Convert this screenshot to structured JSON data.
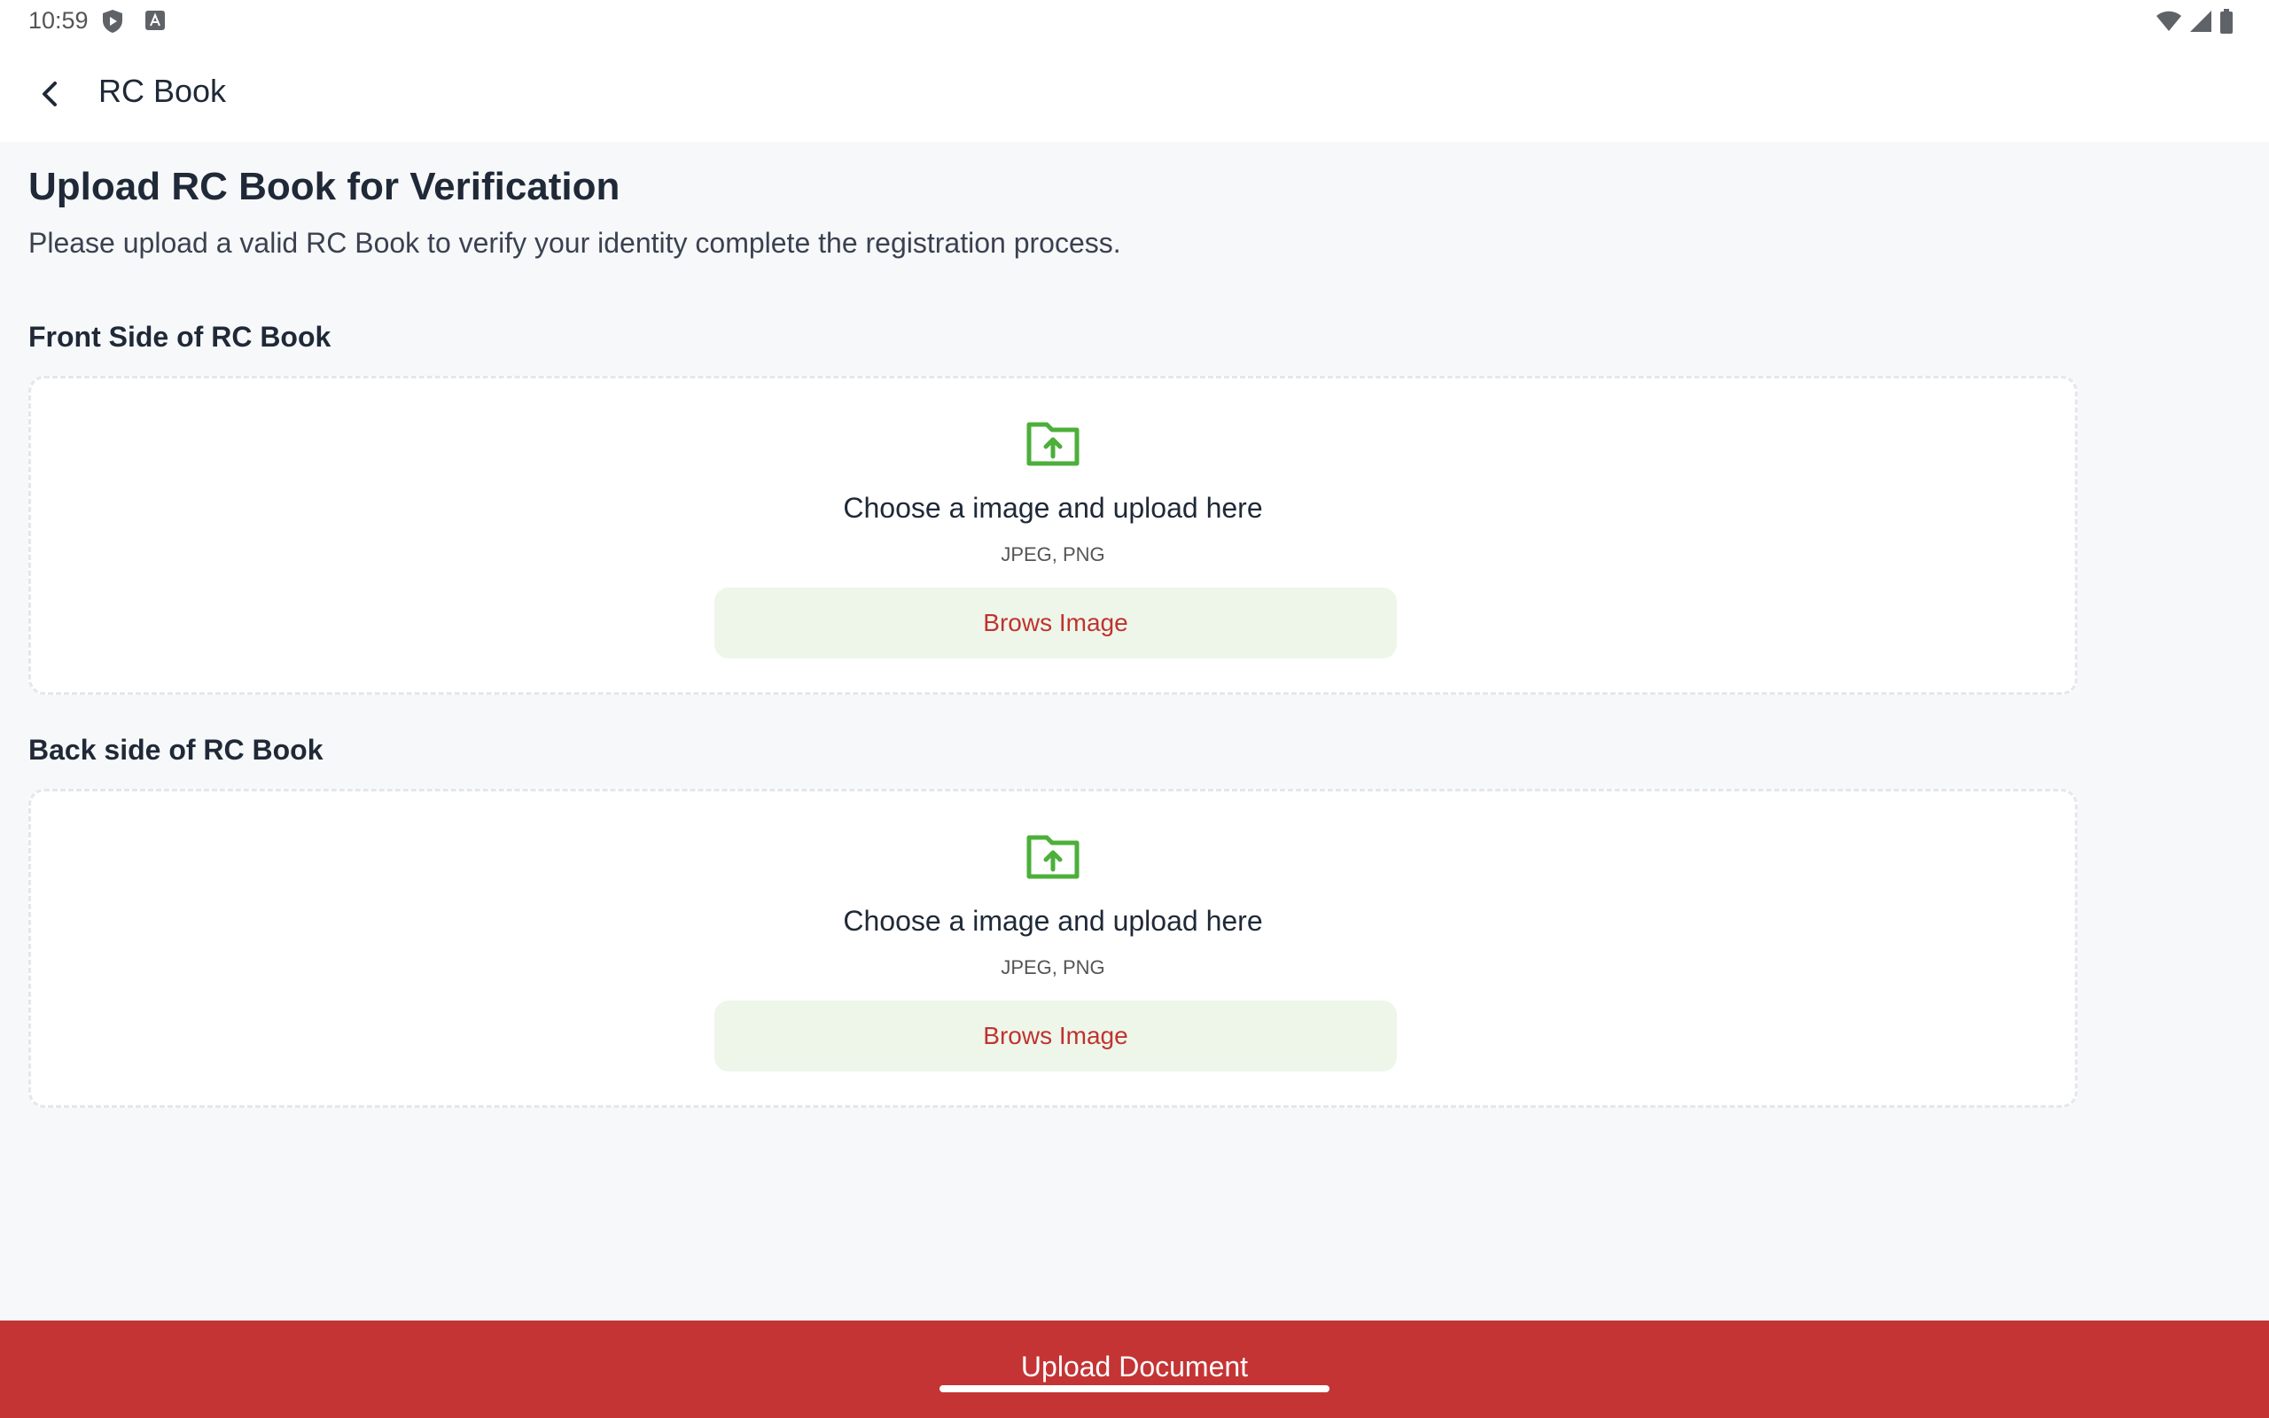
{
  "status_bar": {
    "time": "10:59"
  },
  "app_bar": {
    "title": "RC Book"
  },
  "page": {
    "heading": "Upload RC Book for Verification",
    "description": "Please upload a valid RC Book to verify your identity complete the registration process."
  },
  "sections": [
    {
      "label": "Front Side of RC Book",
      "prompt": "Choose a image and upload here",
      "formats": "JPEG, PNG",
      "button_label": "Brows Image"
    },
    {
      "label": "Back side of RC Book",
      "prompt": "Choose a image and upload here",
      "formats": "JPEG, PNG",
      "button_label": "Brows Image"
    }
  ],
  "footer": {
    "button_label": "Upload Document"
  },
  "colors": {
    "accent_red": "#c43434",
    "icon_green": "#4caf3a",
    "button_bg": "#eef6ea"
  },
  "icons": {
    "back": "arrow-back-icon",
    "upload": "folder-upload-icon"
  }
}
